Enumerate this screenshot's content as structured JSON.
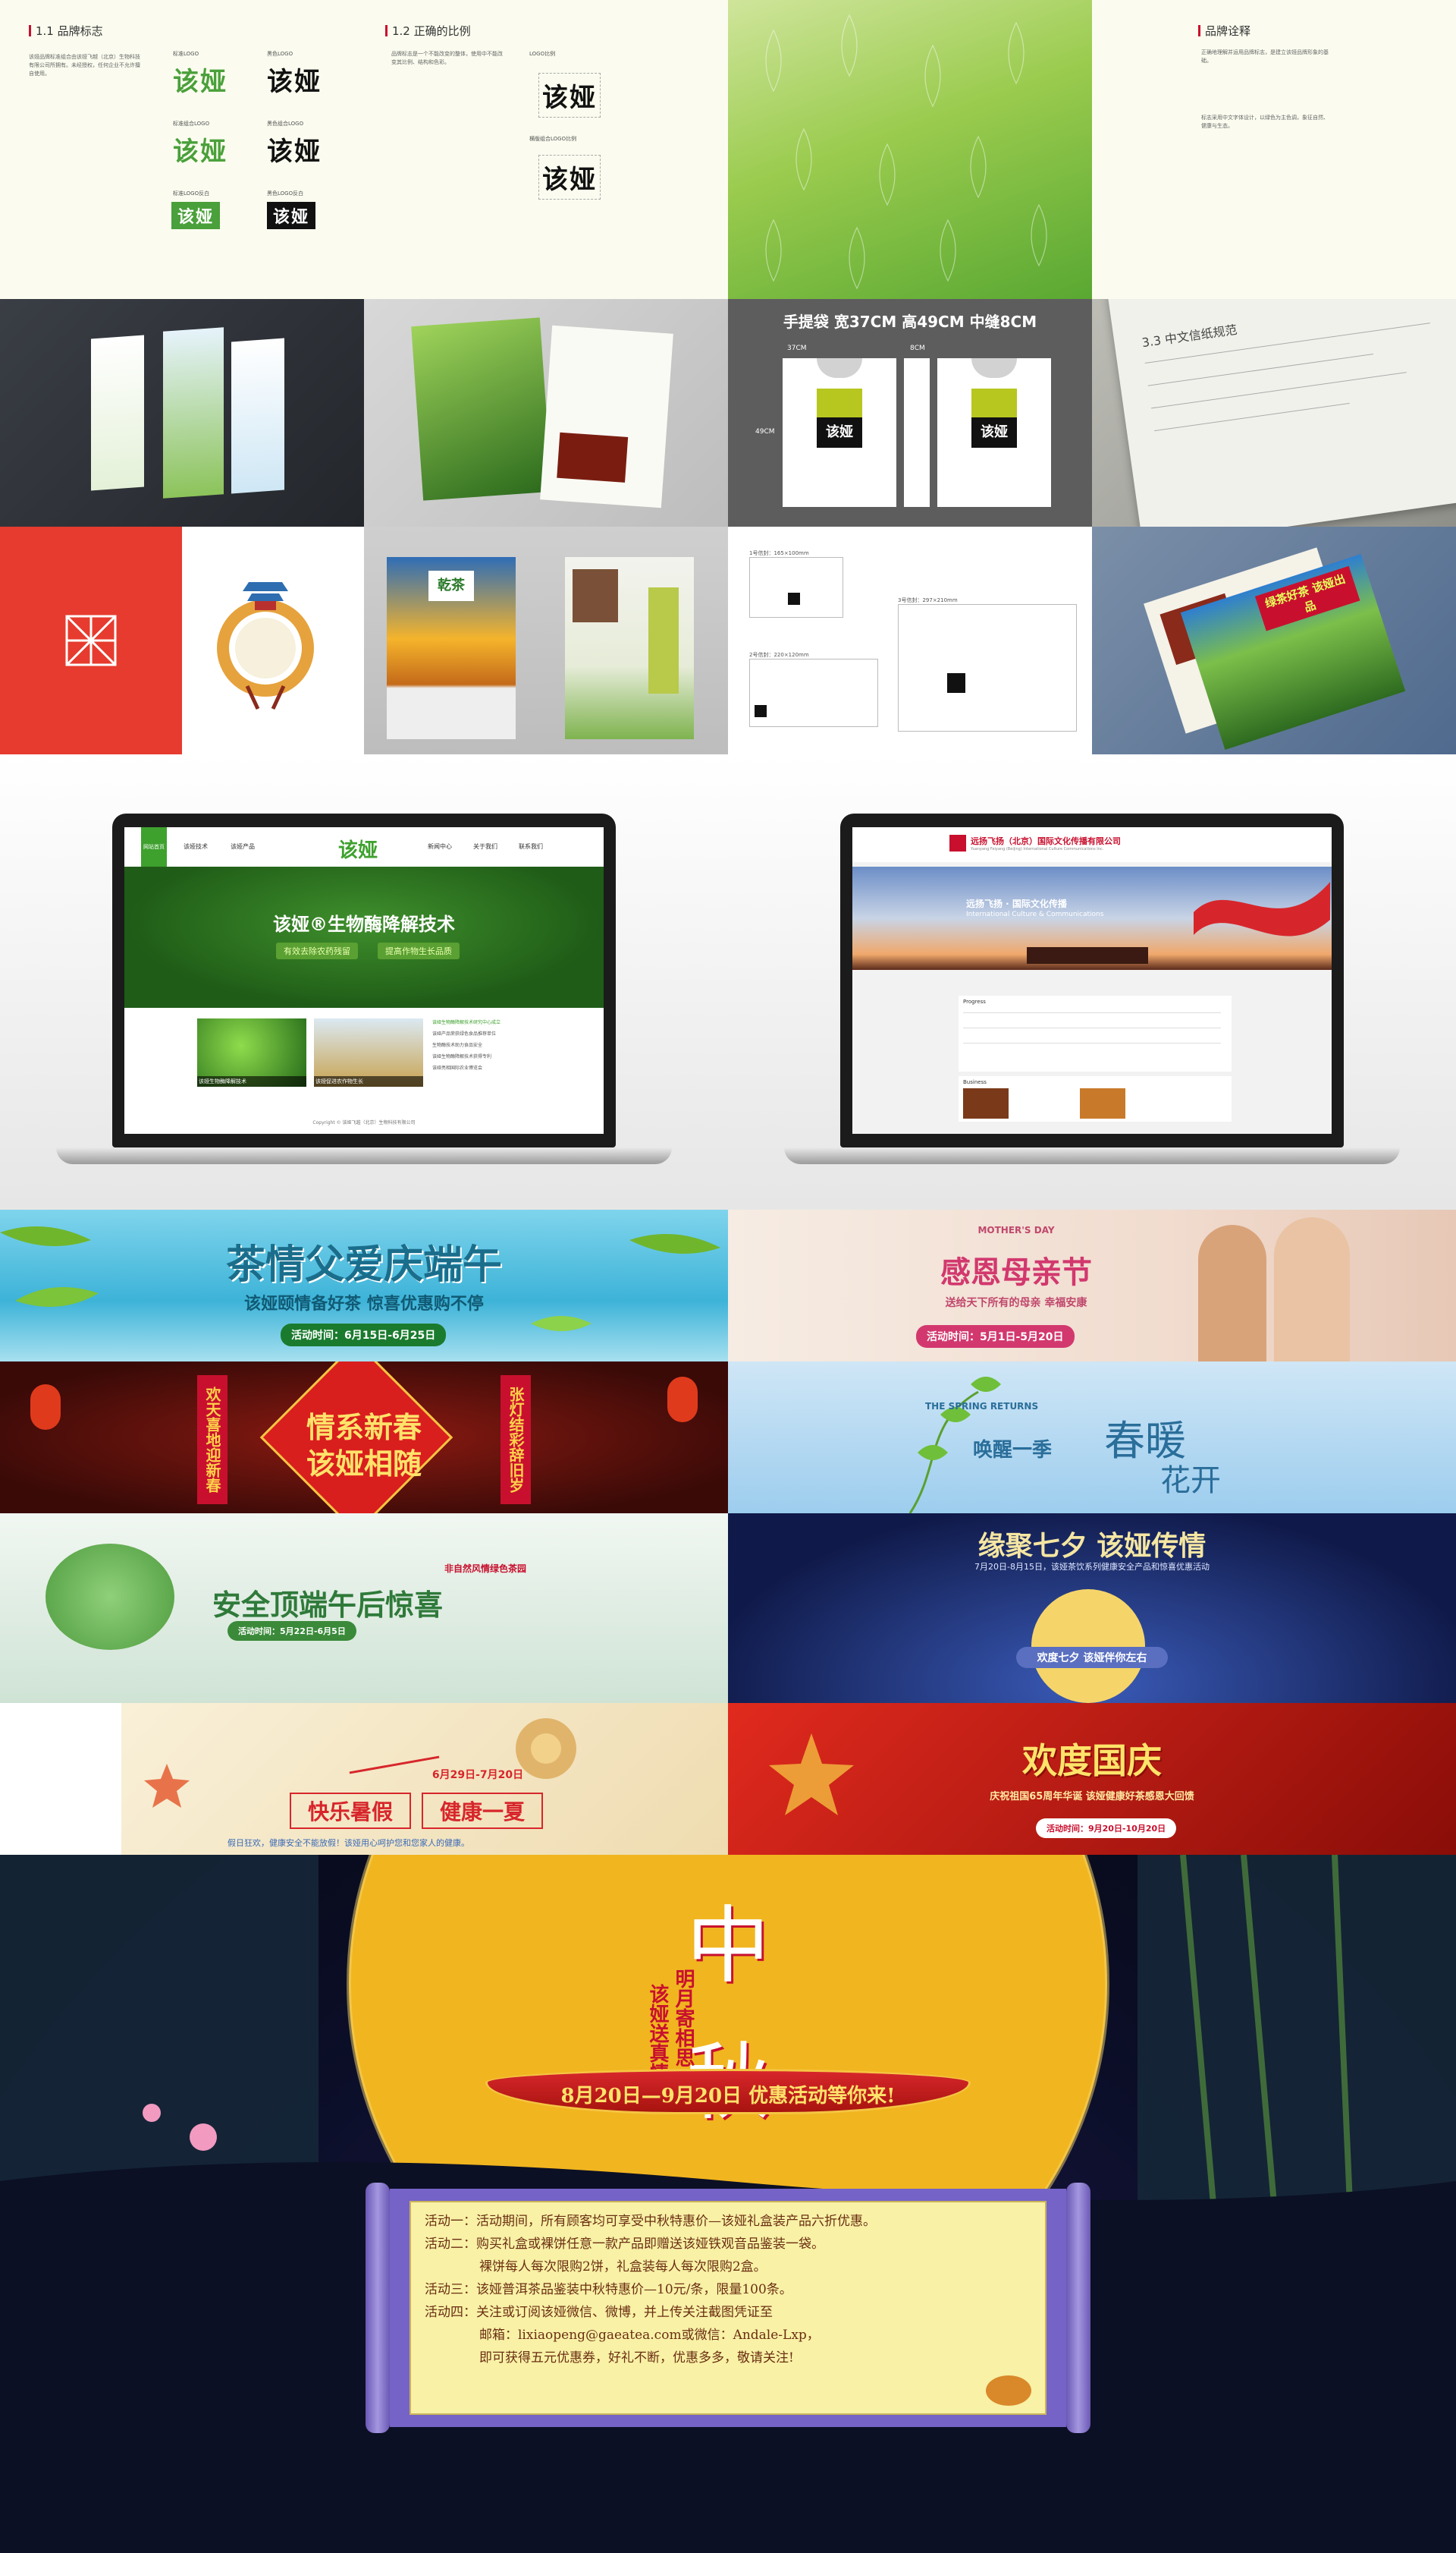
{
  "brand_sheet": {
    "logo_section_title": "1.1 品牌标志",
    "logo_section_text": "该娅品牌标准组合由该娅飞越（北京）生物科技有限公司所拥有。未经授权，任何企业不允许擅自使用。",
    "logo_variants": [
      {
        "label": "标准LOGO",
        "text": "该娅",
        "style": "green"
      },
      {
        "label": "黑色LOGO",
        "text": "该娅",
        "style": "black"
      },
      {
        "label": "标准组合LOGO",
        "text": "该娅",
        "style": "green"
      },
      {
        "label": "黑色组合LOGO",
        "text": "该娅",
        "style": "black"
      },
      {
        "label": "标准LOGO反白",
        "text": "该娅",
        "style": "green-box"
      },
      {
        "label": "黑色LOGO反白",
        "text": "该娅",
        "style": "black-box"
      }
    ],
    "ratio_section_title": "1.2 正确的比例",
    "ratio_section_text": "品牌标志是一个不能改变的整体，使用中不能改变其比例、结构和色彩。",
    "ratio_labels": [
      "LOGO比例",
      "横版组合LOGO比例"
    ],
    "ratio_logo_text": "该娅",
    "interpretation_title": "品牌诠释",
    "interpretation_paragraphs": [
      "正确地理解并运用品牌标志，是建立该娅品牌形象的基础。",
      "标志采用中文字体设计，以绿色为主色调，象征自然、健康与生态。"
    ]
  },
  "mockups": {
    "bag_spec": "手提袋 宽37CM 高49CM 中缝8CM",
    "bag_dims": [
      "37CM",
      "8CM",
      "49CM"
    ],
    "bag_logo": "该娅",
    "letterhead_title": "3.3 中文信纸规范",
    "envelope_labels": [
      "1号信封：165×100mm",
      "2号信封：220×120mm",
      "3号信封：297×210mm"
    ],
    "poster_logo": "乾茶",
    "brochure_title": "绿茶好茶 该娅出品"
  },
  "websites": {
    "site1": {
      "nav": [
        "网站首页",
        "该娅技术",
        "该娅产品",
        "新闻中心",
        "关于我们",
        "联系我们"
      ],
      "logo": "该娅",
      "hero_title": "该娅®生物酶降解技术",
      "hero_tags": [
        "有效去除农药残留",
        "提高作物生长品质"
      ],
      "news": [
        "该娅生物酶降解技术研究中心成立",
        "该娅产品荣获绿色食品推荐单位",
        "生物酶技术助力食品安全",
        "该娅生物酶降解技术获得专利",
        "该娅亮相国际农业博览会"
      ],
      "captions": [
        "该娅生物酶降解技术",
        "该娅促进农作物生长"
      ],
      "footer": "Copyright © 该娅飞越（北京）生物科技有限公司"
    },
    "site2": {
      "company": "远扬飞扬（北京）国际文化传播有限公司",
      "company_en": "Yuanyang Feiyang (Beijing) International Culture Communications Inc.",
      "hero_cn": "远扬飞扬 · 国际文化传播",
      "hero_en": "International Culture & Communications",
      "sections": [
        "Progress",
        "Business"
      ]
    }
  },
  "banners": [
    {
      "title": "茶情父爱庆端午",
      "subtitle": "该娅颐情备好茶  惊喜优惠购不停",
      "date": "活动时间：6月15日-6月25日"
    },
    {
      "title": "感恩母亲节",
      "tag": "MOTHER'S DAY",
      "subtitle": "送给天下所有的母亲 幸福安康",
      "date": "活动时间：5月1日-5月20日"
    },
    {
      "title": "情系新春",
      "title2": "该娅相随",
      "left": "欢天喜地迎新春",
      "right": "张灯结彩辞旧岁"
    },
    {
      "title": "春暖",
      "title2": "花开",
      "lead": "唤醒一季",
      "en": "THE SPRING RETURNS"
    },
    {
      "title": "安全顶端午后惊喜",
      "small": "非自然风情绿色茶园",
      "date": "活动时间：5月22日-6月5日"
    },
    {
      "title": "缘聚七夕 该娅传情",
      "subtitle": "7月20日-8月15日，该娅茶饮系列健康安全产品和惊喜优惠活动",
      "moon": "欢度七夕 该娅伴你左右"
    },
    {
      "title1": "快乐暑假",
      "title2": "健康一夏",
      "date": "6月29日-7月20日",
      "bottom": "假日狂欢，健康安全不能放假！该娅用心呵护您和您家人的健康。"
    },
    {
      "title": "欢度国庆",
      "subtitle": "庆祝祖国65周年华诞 该娅健康好茶感恩大回馈",
      "date": "活动时间：9月20日-10月20日"
    }
  ],
  "mid_autumn": {
    "title": "中秋",
    "poem_left": "该娅送真情",
    "poem_right": "明月寄相思",
    "ribbon": "8月20日—9月20日 优惠活动等你来!",
    "activities": [
      "活动一：活动期间，所有顾客均可享受中秋特惠价—该娅礼盒装产品六折优惠。",
      "活动二：购买礼盒或裸饼任意一款产品即赠送该娅铁观音品鉴装一袋。",
      "裸饼每人每次限购2饼，礼盒装每人每次限购2盒。",
      "活动三：该娅普洱茶品鉴装中秋特惠价—10元/条，限量100条。",
      "活动四：关注或订阅该娅微信、微博，并上传关注截图凭证至",
      "邮箱：lixiaopeng@gaeatea.com或微信：Andale-Lxp，",
      "即可获得五元优惠券，好礼不断，优惠多多，敬请关注!"
    ]
  },
  "colors": {
    "brand_green": "#4aa03a",
    "red": "#d7262b",
    "gold": "#f5c542"
  }
}
